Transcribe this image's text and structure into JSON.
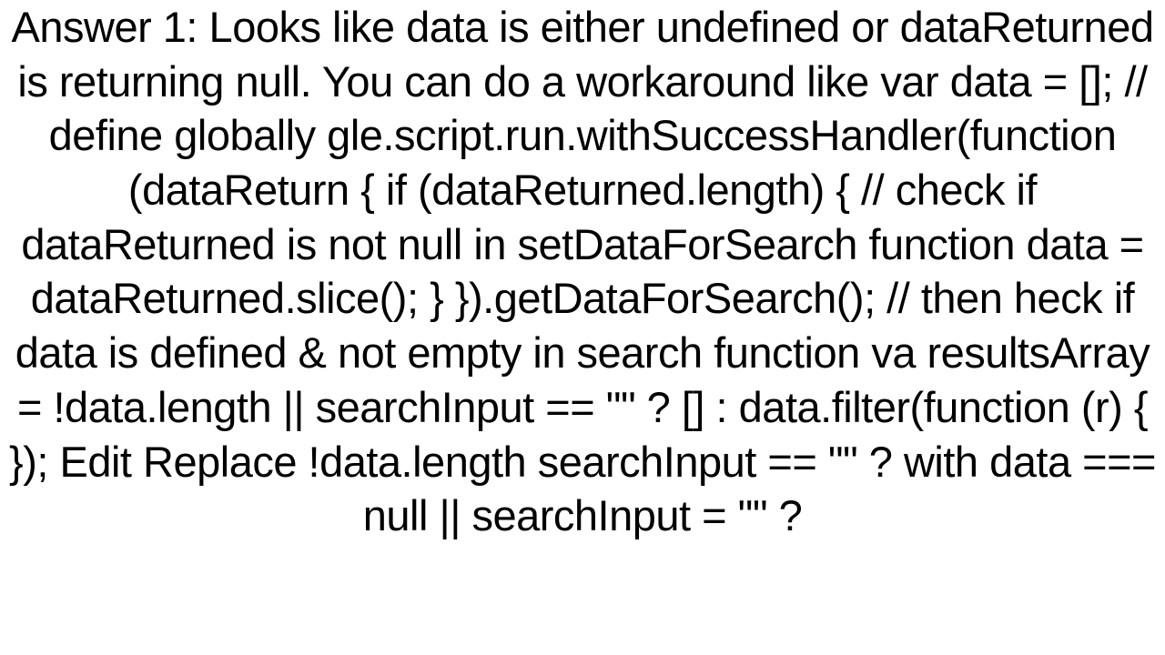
{
  "answer": {
    "text": "Answer 1: Looks like data is either undefined or dataReturned is returning null. You can do a workaround like var data = []; // define globally gle.script.run.withSuccessHandler(function (dataReturn {     if (dataReturned.length) { // check if dataReturned is not null in setDataForSearch function         data = dataReturned.slice();     } }).getDataForSearch();  // then heck if data is defined & not empty in search function va resultsArray = !data.length || searchInput == \"\" ? [] : data.filter(function (r) {  });  Edit Replace !data.length searchInput == \"\" ?  with data === null || searchInput = \"\" ?"
  }
}
